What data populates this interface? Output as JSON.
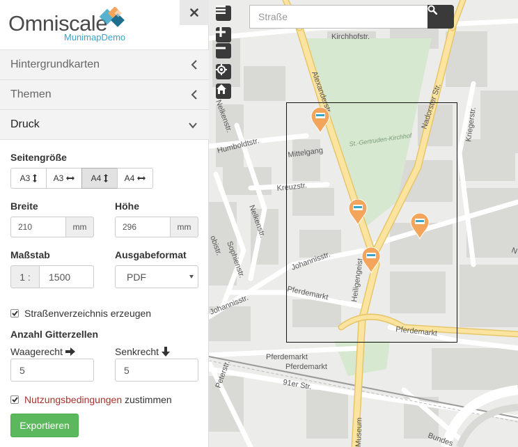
{
  "app": {
    "logo_text": "Omniscale",
    "logo_sub": "MunimapDemo"
  },
  "accordion": {
    "basemaps": "Hintergrundkarten",
    "themes": "Themen",
    "print": "Druck"
  },
  "print": {
    "page_size_label": "Seitengröße",
    "page_sizes": [
      "A3",
      "A3",
      "A4",
      "A4"
    ],
    "page_size_selected": "A4 hochkant",
    "width_label": "Breite",
    "width_value": "210",
    "width_unit": "mm",
    "height_label": "Höhe",
    "height_value": "296",
    "height_unit": "mm",
    "scale_label": "Maßstab",
    "scale_prefix": "1 :",
    "scale_value": "1500",
    "format_label": "Ausgabeformat",
    "format_value": "PDF",
    "street_index_label": "Straßenverzeichnis erzeugen",
    "street_index_checked": true,
    "grid_label": "Anzahl Gitterzellen",
    "horizontal_label": "Waagerecht",
    "horizontal_value": "5",
    "vertical_label": "Senkrecht",
    "vertical_value": "5",
    "terms_link": "Nutzungsbedingungen",
    "terms_suffix": "zustimmen",
    "terms_checked": true,
    "export_label": "Exportieren"
  },
  "map": {
    "search_placeholder": "Straße",
    "streets": {
      "kirchhofstr": "Kirchhofstr.",
      "alexanderstr": "Alexanderstr.",
      "nadorster": "Nadorster Str.",
      "kriegerstr": "Kriegerstr.",
      "nelkenstr_top": "Nelkenstr.",
      "humboldtstr": "Humboldtstr.",
      "mittelgang": "Mittelgang",
      "kreuzstr": "Kreuzstr.",
      "nelkenstr": "Nelkenstr.",
      "johannisstr": "Johannisstr.",
      "johannisstr_low": "Johannisstr.",
      "sophienstr": "Sophienstr.",
      "heiligengeist": "Heiligengeist",
      "pferdemarkt_a": "Pferdemarkt",
      "pferdemarkt_b": "Pferdemarkt",
      "pferdemarkt_c": "Pferdemarkt",
      "pferdemarkt_d": "Pferdemarkt",
      "str91er": "91er Str.",
      "peterstr": "Peterstr.",
      "museum": "Museum",
      "bundes": "Bundes",
      "gertruden": "St.-Gertruden-Kirchhof",
      "obistr": "obistr.",
      "n_edge": "N"
    }
  },
  "colors": {
    "map_bg": "#ececea",
    "park": "#d6e8cf",
    "main_road": "#fbe3a0",
    "poi": "#f3a55b",
    "export": "#5cb85c",
    "link": "#a8322d"
  }
}
